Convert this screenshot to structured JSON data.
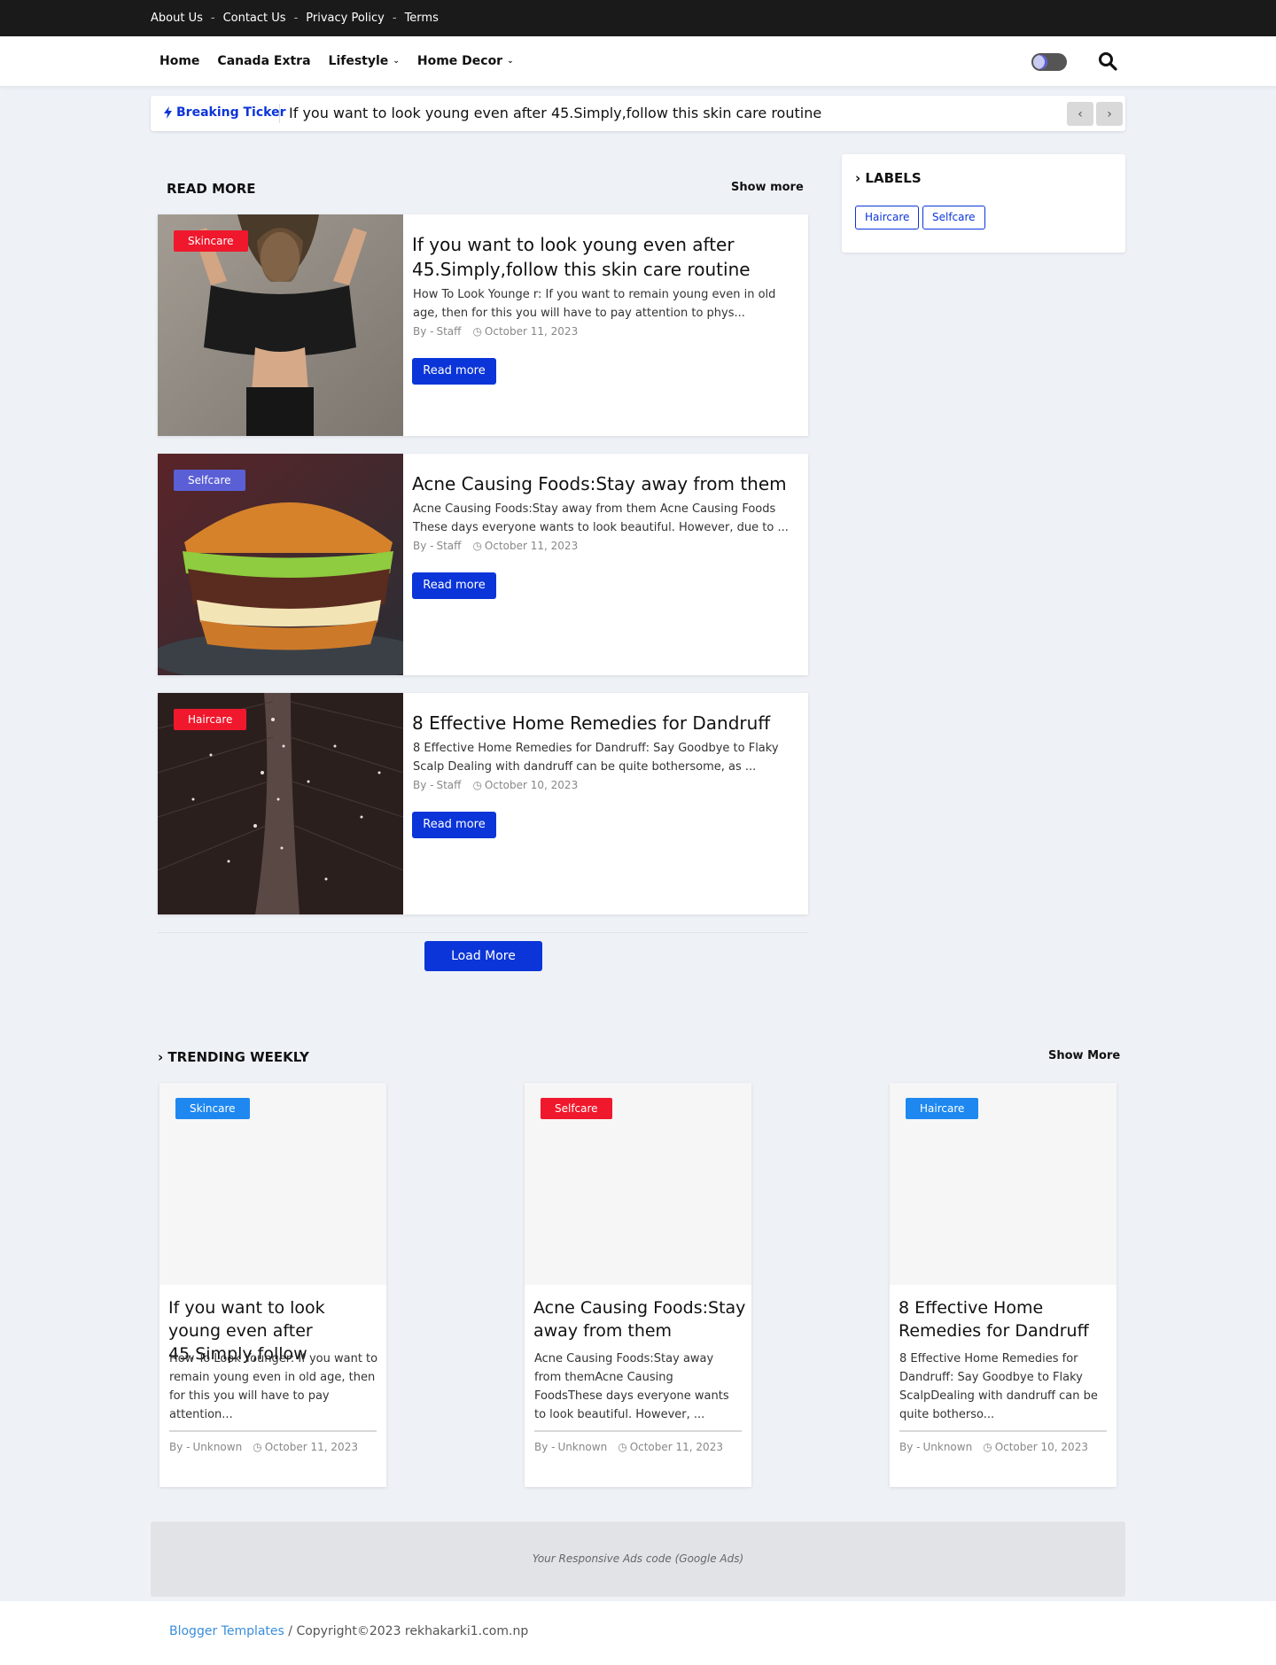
{
  "topbar": {
    "links": [
      "About Us",
      "Contact Us",
      "Privacy Policy",
      "Terms"
    ]
  },
  "nav": {
    "items": [
      {
        "label": "Home",
        "dropdown": false
      },
      {
        "label": "Canada Extra",
        "dropdown": false
      },
      {
        "label": "Lifestyle",
        "dropdown": true
      },
      {
        "label": "Home Decor",
        "dropdown": true
      }
    ],
    "icons": {
      "theme_toggle": "moon-toggle-icon",
      "search": "search-icon"
    }
  },
  "ticker": {
    "label": "Breaking Ticker",
    "headline": "If you want to look young even after 45.Simply,follow this skin care routine"
  },
  "read_more": {
    "title": "READ MORE",
    "show_more": "Show more",
    "posts": [
      {
        "badge": "Skincare",
        "badge_color": "#f0182c",
        "title": "If you want to look young even after 45.Simply,follow this skin care routine",
        "excerpt": "How To Look Younge r: If you want to remain young even in old age, then for this you will have to pay attention to phys...",
        "by": "By -",
        "author": "Staff",
        "date": "October 11, 2023",
        "button": "Read more"
      },
      {
        "badge": "Selfcare",
        "badge_color": "#5b5fd6",
        "title": "Acne Causing Foods:Stay away from them",
        "excerpt": "Acne Causing Foods:Stay away from them Acne Causing Foods These days everyone wants to look beautiful. However, due to ...",
        "by": "By -",
        "author": "Staff",
        "date": "October 11, 2023",
        "button": "Read more"
      },
      {
        "badge": "Haircare",
        "badge_color": "#f0182c",
        "title": "8 Effective Home Remedies for Dandruff",
        "excerpt": "8 Effective Home Remedies for Dandruff: Say Goodbye to Flaky Scalp Dealing with dandruff can be quite bothersome, as ...",
        "by": "By -",
        "author": "Staff",
        "date": "October 10, 2023",
        "button": "Read more"
      }
    ],
    "load_more": "Load More"
  },
  "sidebar": {
    "labels_title": "LABELS",
    "labels": [
      "Haircare",
      "Selfcare"
    ]
  },
  "trending": {
    "title": "TRENDING WEEKLY",
    "show_more": "Show More",
    "cards": [
      {
        "badge": "Skincare",
        "badge_color": "#1e88f0",
        "title": "If you want to look young even after 45.Simply,follow",
        "excerpt": "How To Look Younger: If you want to remain young even in old age, then for this you will have to pay attention...",
        "by": "By -",
        "author": "Unknown",
        "date": "October 11, 2023"
      },
      {
        "badge": "Selfcare",
        "badge_color": "#f0182c",
        "title": "Acne Causing Foods:Stay away from them",
        "excerpt": "Acne Causing Foods:Stay away from themAcne Causing FoodsThese days everyone wants to look beautiful. However, ...",
        "by": "By -",
        "author": "Unknown",
        "date": "October 11, 2023"
      },
      {
        "badge": "Haircare",
        "badge_color": "#1e88f0",
        "title": "8 Effective Home Remedies for Dandruff",
        "excerpt": " 8 Effective Home Remedies for Dandruff: Say Goodbye to Flaky ScalpDealing with dandruff can be quite botherso...",
        "by": "By -",
        "author": "Unknown",
        "date": "October 10, 2023"
      }
    ]
  },
  "ads": {
    "text": "Your Responsive Ads code (Google Ads)"
  },
  "footer": {
    "link": "Blogger Templates",
    "copyright": " / Copyright©2023 rekhakarki1.com.np"
  }
}
